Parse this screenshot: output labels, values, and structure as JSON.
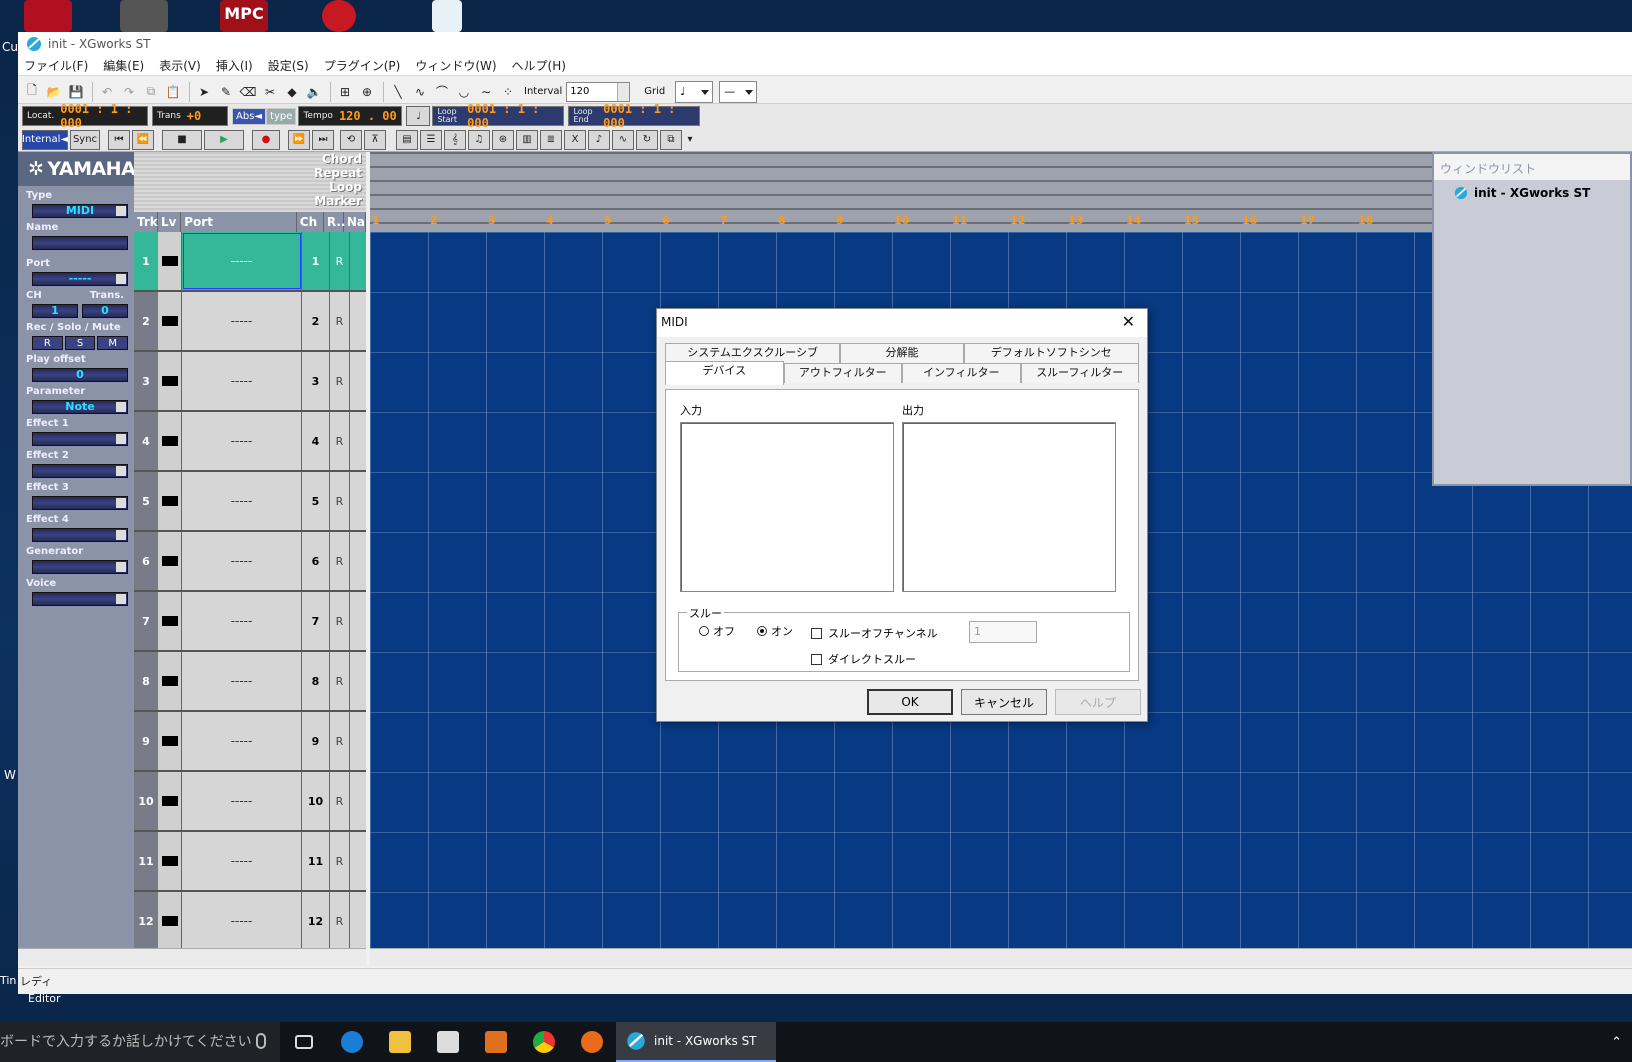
{
  "desktop": {
    "icons": [
      "cubase-icon",
      "vst-icon",
      "mpc-icon",
      "target-icon",
      "cd-icon"
    ],
    "mpc_label": "MPC",
    "side_texts": [
      "Cu",
      "W",
      "Tin",
      "Editor"
    ]
  },
  "window": {
    "title": "init - XGworks ST",
    "menu": [
      "ファイル(F)",
      "編集(E)",
      "表示(V)",
      "挿入(I)",
      "設定(S)",
      "プラグイン(P)",
      "ウィンドウ(W)",
      "ヘルプ(H)"
    ]
  },
  "toolbar": {
    "interval_label": "Interval",
    "interval_value": "120",
    "grid_label": "Grid",
    "grid_value": "♩",
    "dash_value": "—"
  },
  "transport": {
    "locate_label": "Locat.",
    "locate_value": "0001 : 1 : 000",
    "trans_label": "Trans",
    "trans_value": "+0",
    "abs_label": "Abs◄",
    "type_label": "type",
    "tempo_label": "Tempo",
    "tempo_value": "120 . 00",
    "loop_start_label": "Loop Start",
    "loop_start_value": "0001 : 1 : 000",
    "loop_end_label": "Loop End",
    "loop_end_value": "0001 : 1 : 000",
    "internal_label": "Internal◄",
    "sync_label": "Sync"
  },
  "inspector": {
    "brand": "YAMAHA",
    "type_label": "Type",
    "type_value": "MIDI",
    "name_label": "Name",
    "port_label": "Port",
    "port_value": "-----",
    "ch_label": "CH",
    "trans_label": "Trans.",
    "ch_value": "1",
    "trans_value": "0",
    "rsm_label": "Rec / Solo / Mute",
    "rsm": [
      "R",
      "S",
      "M"
    ],
    "playoffset_label": "Play offset",
    "playoffset_value": "0",
    "parameter_label": "Parameter",
    "parameter_value": "Note",
    "effect1_label": "Effect 1",
    "effect2_label": "Effect 2",
    "effect3_label": "Effect 3",
    "effect4_label": "Effect 4",
    "generator_label": "Generator",
    "voice_label": "Voice"
  },
  "markers": [
    "Chord",
    "Repeat",
    "Loop",
    "Marker"
  ],
  "track_headers": [
    "Trk",
    "Lv",
    "Port",
    "Ch",
    "R..",
    "Na"
  ],
  "tracks": [
    {
      "num": "1",
      "port": "-----",
      "ch": "1",
      "r": "R"
    },
    {
      "num": "2",
      "port": "-----",
      "ch": "2",
      "r": "R"
    },
    {
      "num": "3",
      "port": "-----",
      "ch": "3",
      "r": "R"
    },
    {
      "num": "4",
      "port": "-----",
      "ch": "4",
      "r": "R"
    },
    {
      "num": "5",
      "port": "-----",
      "ch": "5",
      "r": "R"
    },
    {
      "num": "6",
      "port": "-----",
      "ch": "6",
      "r": "R"
    },
    {
      "num": "7",
      "port": "-----",
      "ch": "7",
      "r": "R"
    },
    {
      "num": "8",
      "port": "-----",
      "ch": "8",
      "r": "R"
    },
    {
      "num": "9",
      "port": "-----",
      "ch": "9",
      "r": "R"
    },
    {
      "num": "10",
      "port": "-----",
      "ch": "10",
      "r": "R"
    },
    {
      "num": "11",
      "port": "-----",
      "ch": "11",
      "r": "R"
    },
    {
      "num": "12",
      "port": "-----",
      "ch": "12",
      "r": "R"
    }
  ],
  "ruler_bars": [
    "1",
    "2",
    "3",
    "4",
    "5",
    "6",
    "7",
    "8",
    "9",
    "10",
    "11",
    "12",
    "13",
    "14",
    "15",
    "16",
    "17",
    "18"
  ],
  "window_list": {
    "title": "ウィンドウリスト",
    "item": "init - XGworks ST"
  },
  "status": {
    "text": "レディ"
  },
  "dialog": {
    "title": "MIDI",
    "tabs_back": [
      "システムエクスクルーシブ",
      "分解能",
      "デフォルトソフトシンセ"
    ],
    "tabs_front": [
      "デバイス",
      "アウトフィルター",
      "インフィルター",
      "スルーフィルター"
    ],
    "input_label": "入力",
    "output_label": "出力",
    "thru_group": "スルー",
    "thru_off": "オフ",
    "thru_on": "オン",
    "thru_off_channel": "スルーオフチャンネル",
    "direct_thru": "ダイレクトスルー",
    "channel_value": "1",
    "ok": "OK",
    "cancel": "キャンセル",
    "help": "ヘルプ"
  },
  "taskbar": {
    "search_placeholder": "ボードで入力するか話しかけてください",
    "active_app": "init - XGworks ST"
  },
  "colors": {
    "arrange_bg": "#073a82",
    "selected_track": "#35b89a",
    "lcd_text": "#ff9a1a",
    "inspector_bg": "#8a93a8"
  }
}
